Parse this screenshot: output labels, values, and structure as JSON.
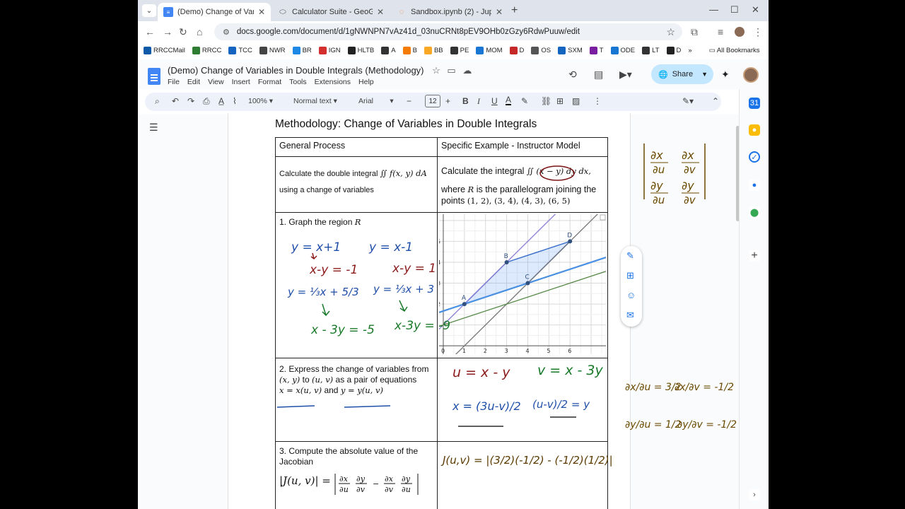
{
  "browser": {
    "tabs": [
      {
        "title": "(Demo) Change of Variables in",
        "active": true,
        "icon": "docs-icon"
      },
      {
        "title": "Calculator Suite - GeoGebra",
        "active": false,
        "icon": "geogebra-icon"
      },
      {
        "title": "Sandbox.ipynb (2) - JupyterLab",
        "active": false,
        "icon": "jupyter-icon"
      }
    ],
    "url": "docs.google.com/document/d/1gNWNPN7vAz41d_03nuCRNt8pEV9OHb0zGzy6RdwPuuw/edit",
    "bookmarks": [
      {
        "label": "RRCCMail",
        "color": "#0f5aa8"
      },
      {
        "label": "RRCC",
        "color": "#2e7d32"
      },
      {
        "label": "TCC",
        "color": "#1565c0"
      },
      {
        "label": "NWR",
        "color": "#444"
      },
      {
        "label": "BR",
        "color": "#1e88e5"
      },
      {
        "label": "IGN",
        "color": "#d32f2f"
      },
      {
        "label": "HLTB",
        "color": "#222"
      },
      {
        "label": "A",
        "color": "#333"
      },
      {
        "label": "B",
        "color": "#f57c00"
      },
      {
        "label": "BB",
        "color": "#f9a825"
      },
      {
        "label": "PE",
        "color": "#333"
      },
      {
        "label": "MOM",
        "color": "#1976d2"
      },
      {
        "label": "D",
        "color": "#c62828"
      },
      {
        "label": "OS",
        "color": "#555"
      },
      {
        "label": "SXM",
        "color": "#1565c0"
      },
      {
        "label": "T",
        "color": "#7b1fa2"
      },
      {
        "label": "ODE",
        "color": "#1976d2"
      },
      {
        "label": "LT",
        "color": "#333"
      },
      {
        "label": "D",
        "color": "#222"
      }
    ],
    "all_bookmarks": "All Bookmarks"
  },
  "docs": {
    "title": "(Demo) Change of Variables in Double Integrals (Methodology)",
    "menu": [
      "File",
      "Edit",
      "View",
      "Insert",
      "Format",
      "Tools",
      "Extensions",
      "Help"
    ],
    "share_label": "Share",
    "zoom": "100%",
    "style": "Normal text",
    "font": "Arial",
    "font_size": "12"
  },
  "document": {
    "heading": "Methodology: Change of Variables in Double Integrals",
    "table": {
      "headers": [
        "General Process",
        "Specific Example - Instructor Model"
      ],
      "row1": {
        "left_a": "Calculate the double integral",
        "left_math": "∬ f(x, y) dA",
        "left_sub": "R",
        "left_b": "using a change of variables",
        "right_a": "Calculate the integral",
        "right_math": "∬ (x − y) dy dx,",
        "right_b": "where",
        "right_R": "R",
        "right_c": "is the parallelogram joining the",
        "right_d": "points",
        "right_points": "(1, 2), (3, 4), (4, 3), (6, 5)"
      },
      "row2": {
        "left": "1. Graph the region",
        "left_R": "R"
      },
      "row3": {
        "left_a": "2. Express the change of variables from",
        "left_xy": "(x, y)",
        "left_to": "to",
        "left_uv": "(u, v)",
        "left_b": "as a pair of equations",
        "left_eq1": "x = x(u, v)",
        "left_and": "and",
        "left_eq2": "y = y(u, v)"
      },
      "row4": {
        "left_a": "3. Compute the absolute value of the Jacobian",
        "left_J": "|J(u, v)| ="
      }
    }
  },
  "graph": {
    "x_ticks": [
      "0",
      "1",
      "2",
      "3",
      "4",
      "5",
      "6"
    ],
    "y_ticks": [
      "2",
      "3",
      "4",
      "5"
    ],
    "points": [
      {
        "label": "A",
        "x": 1,
        "y": 2
      },
      {
        "label": "B",
        "x": 3,
        "y": 4
      },
      {
        "label": "C",
        "x": 4,
        "y": 3
      },
      {
        "label": "D",
        "x": 6,
        "y": 5
      }
    ]
  },
  "handwriting": {
    "eq1": "y = x+1",
    "eq1b": "x-y = -1",
    "eq1c": "y = ⅓x + 5/3",
    "eq1d": "x - 3y = -5",
    "eq2": "y = x-1",
    "eq2b": "x-y = 1",
    "eq2c": "y = ⅓x + 3",
    "eq2d": "x-3y = -9",
    "u_def": "u = x - y",
    "v_def": "v = x - 3y",
    "x_sol": "x = (3u-v)/2",
    "y_sol": "(u-v)/2 = y",
    "jacobian": "J(u,v) = |(3/2)(-1/2) - (-1/2)(1/2)|",
    "matrix": "|∂x/∂u  ∂x/∂v ; ∂y/∂u  ∂y/∂v|",
    "dxdu": "∂x/∂u = 3/2",
    "dxdv": "∂x/∂v = -1/2",
    "dydu": "∂y/∂u = 1/2",
    "dydv": "∂y/∂v = -1/2"
  }
}
